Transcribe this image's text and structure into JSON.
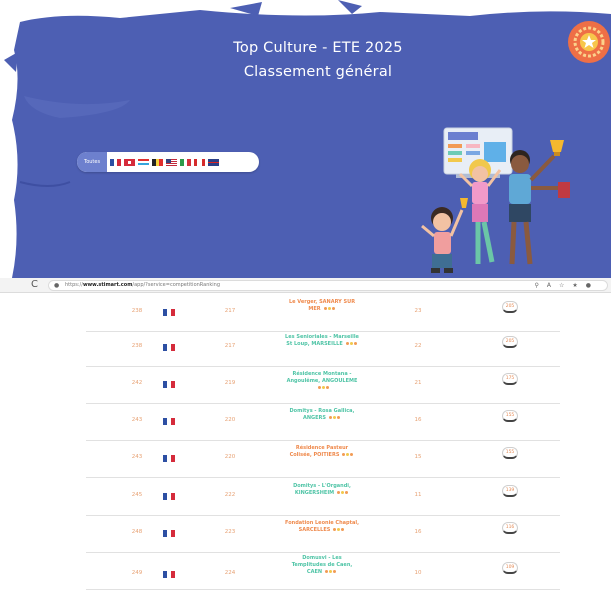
{
  "hero": {
    "title": "Top Culture - ETE 2025",
    "subtitle": "Classement général",
    "filter_all_label": "Toutes",
    "filter_flags": [
      "france",
      "switzerland",
      "luxembourg",
      "belgium",
      "usa",
      "italy",
      "canada",
      "uk"
    ],
    "medal_icon": "laurel-star-medal-icon",
    "illustration": "celebrating-kids-illustration",
    "colors": {
      "background": "#4d5fb3",
      "medal": "#ee6f46",
      "filter_active": "#6d80ce"
    }
  },
  "browser": {
    "reload_glyph": "C",
    "url_prefix": "https://",
    "url_domain": "www.stimart.com",
    "url_path": "/app/?service=competitionRanking"
  },
  "rows": [
    {
      "rank": "238",
      "flag": "france",
      "points": "217",
      "name_line1": "Le Verger, SANARY SUR",
      "name_line2": "MER",
      "name_line3": "",
      "participants": "23",
      "score": "205",
      "name_color": "orange"
    },
    {
      "rank": "238",
      "flag": "france",
      "points": "217",
      "name_line1": "Les Senioriales - Marseille",
      "name_line2": "St Loup, MARSEILLE",
      "name_line3": "",
      "participants": "22",
      "score": "205",
      "name_color": "green"
    },
    {
      "rank": "242",
      "flag": "france",
      "points": "219",
      "name_line1": "Résidence Montana -",
      "name_line2": "Angoulême, ANGOULEME",
      "name_line3": "",
      "participants": "21",
      "score": "175",
      "name_color": "green"
    },
    {
      "rank": "243",
      "flag": "france",
      "points": "220",
      "name_line1": "Domitys - Rosa Gallica,",
      "name_line2": "ANGERS",
      "name_line3": "",
      "participants": "16",
      "score": "155",
      "name_color": "green"
    },
    {
      "rank": "243",
      "flag": "france",
      "points": "220",
      "name_line1": "Résidence Pasteur",
      "name_line2": "Colisée, POITIERS",
      "name_line3": "",
      "participants": "15",
      "score": "155",
      "name_color": "orange"
    },
    {
      "rank": "245",
      "flag": "france",
      "points": "222",
      "name_line1": "Domitys - L'Organdi,",
      "name_line2": "KINGERSHEIM",
      "name_line3": "",
      "participants": "11",
      "score": "139",
      "name_color": "green"
    },
    {
      "rank": "248",
      "flag": "france",
      "points": "223",
      "name_line1": "Fondation Leonie Chaptal,",
      "name_line2": "SARCELLES",
      "name_line3": "",
      "participants": "16",
      "score": "116",
      "name_color": "orange"
    },
    {
      "rank": "249",
      "flag": "france",
      "points": "224",
      "name_line1": "Domusvi - Les",
      "name_line2": "Templitudes de Caen,",
      "name_line3": "CAEN",
      "participants": "10",
      "score": "109",
      "name_color": "green"
    }
  ]
}
